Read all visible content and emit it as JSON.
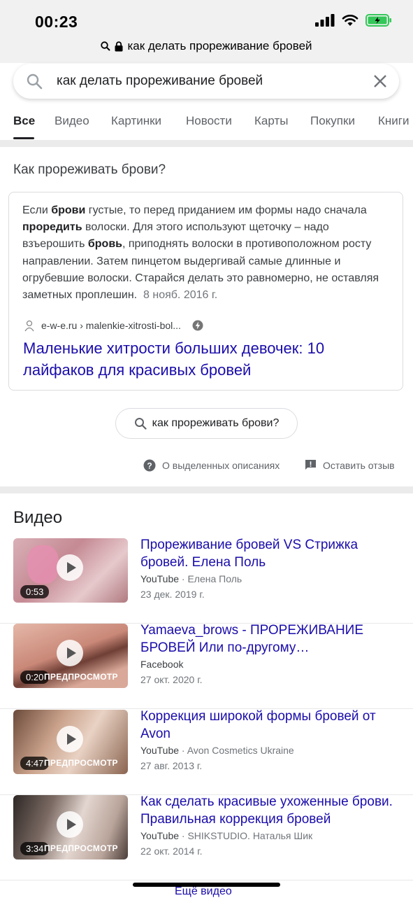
{
  "status": {
    "time": "00:23"
  },
  "browser": {
    "url_text": "как делать прореживание бровей"
  },
  "search": {
    "query": "как делать прореживание бровей"
  },
  "tabs": [
    {
      "label": "Все"
    },
    {
      "label": "Видео"
    },
    {
      "label": "Картинки"
    },
    {
      "label": "Новости"
    },
    {
      "label": "Карты"
    },
    {
      "label": "Покупки"
    },
    {
      "label": "Книги"
    }
  ],
  "featured": {
    "question": "Как прореживать брови?",
    "snippet": {
      "p1": "Если ",
      "b1": "брови",
      "p2": " густые, то перед приданием им формы надо сначала ",
      "b2": "проредить",
      "p3": " волоски. Для этого используют щеточку – надо взъерошить ",
      "b3": "бровь",
      "p4": ", приподнять волоски в противоположном росту направлении. Затем пинцетом выдергивай самые длинные и огрубевшие волоски. Старайся делать это равномерно, не оставляя заметных проплешин.",
      "date": "8 нояб. 2016 г."
    },
    "source": "e-w-e.ru › malenkie-xitrosti-bol...",
    "link": "Маленькие хитрости больших девочек: 10 лайфаков для красивых бровей"
  },
  "related_chip": "как прореживать брови?",
  "footer": {
    "about": "О выделенных описаниях",
    "feedback": "Оставить отзыв"
  },
  "videos": {
    "heading": "Видео",
    "items": [
      {
        "title": "Прореживание бровей VS Стрижка бровей. Елена Поль",
        "source": "YouTube",
        "channel": "Елена Поль",
        "date": "23 дек. 2019 г.",
        "duration": "0:53",
        "preview": ""
      },
      {
        "title": "Yamaeva_brows - ПРОРЕЖИВАНИЕ БРОВЕЙ Или по-другому…",
        "source": "Facebook",
        "channel": "",
        "date": "27 окт. 2020 г.",
        "duration": "0:20",
        "preview": "ПРЕДПРОСМОТР"
      },
      {
        "title": "Коррекция широкой формы бровей от Avon",
        "source": "YouTube",
        "channel": "Avon Cosmetics Ukraine",
        "date": "27 авг. 2013 г.",
        "duration": "4:47",
        "preview": "ПРЕДПРОСМОТР"
      },
      {
        "title": "Как сделать красивые ухоженные брови. Правильная коррекция бровей",
        "source": "YouTube",
        "channel": "SHIKSTUDIO. Наталья Шик",
        "date": "22 окт. 2014 г.",
        "duration": "3:34",
        "preview": "ПРЕДПРОСМОТР"
      }
    ],
    "more": "Ещё видео"
  },
  "colors": {
    "link": "#1a0dab",
    "battery": "#34c759"
  }
}
